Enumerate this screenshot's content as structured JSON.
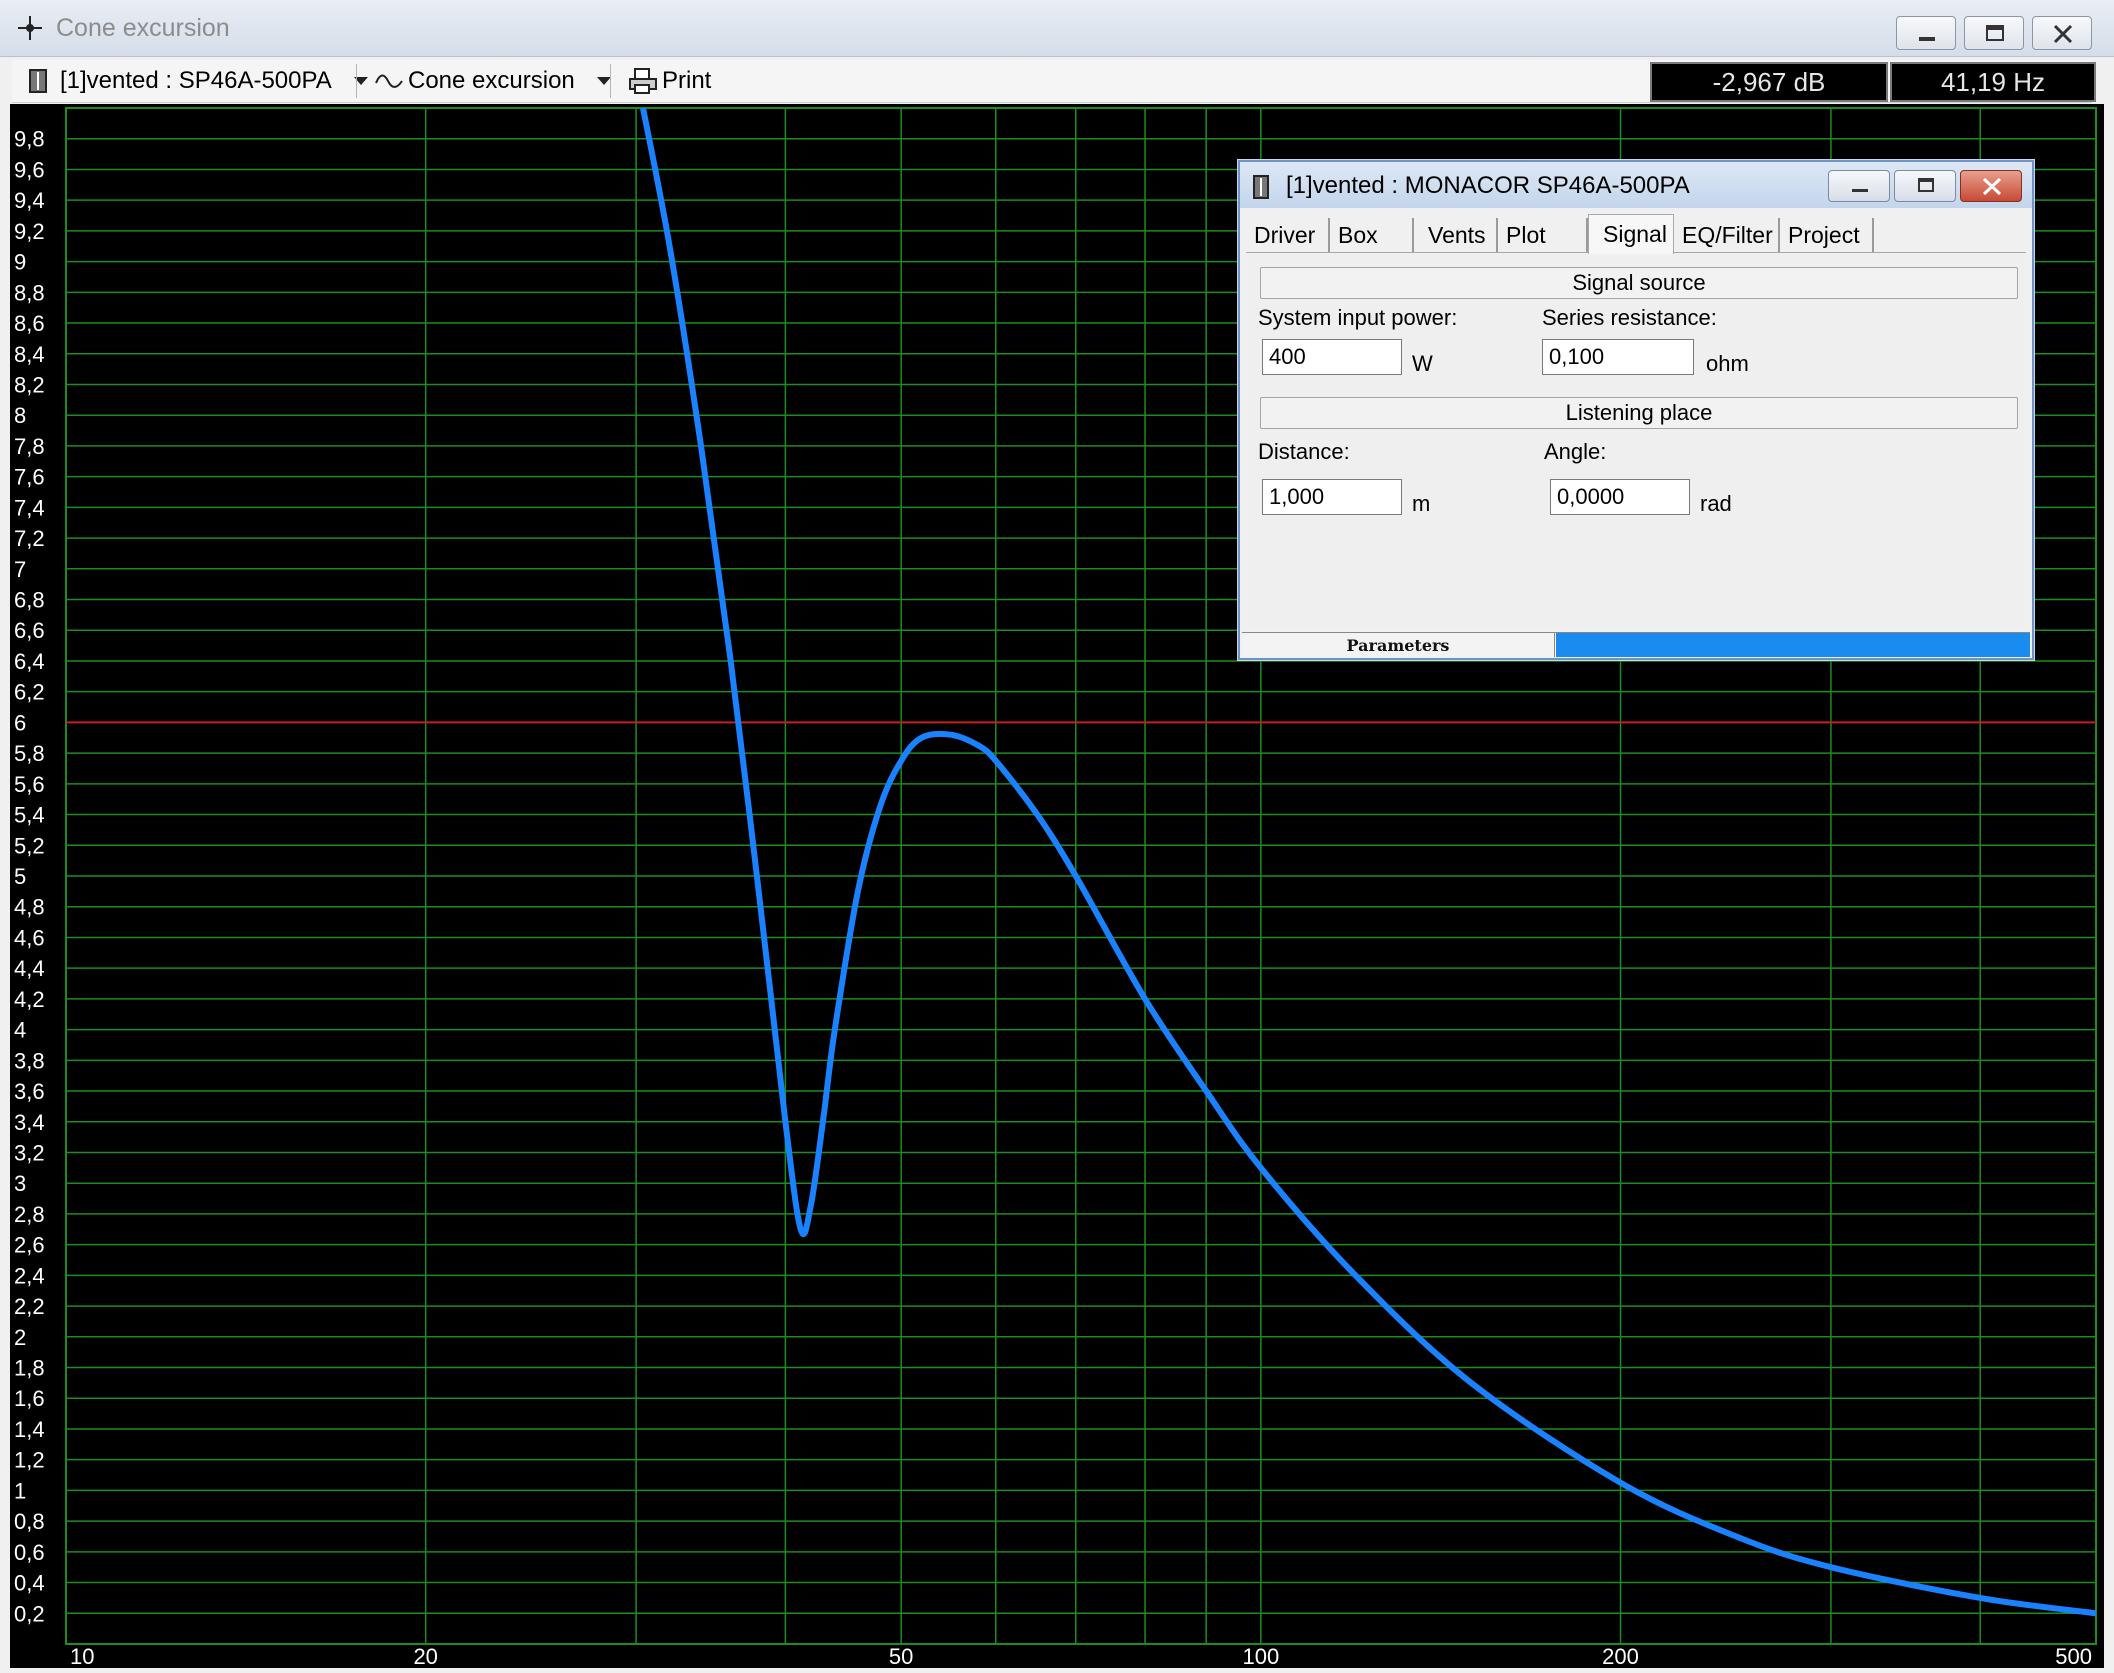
{
  "window": {
    "title": "Cone excursion"
  },
  "toolbar": {
    "project": "[1]vented : SP46A-500PA",
    "view": "Cone excursion",
    "print": "Print"
  },
  "readouts": {
    "level": "-2,967 dB",
    "frequency": "41,19 Hz"
  },
  "dialog": {
    "title": "[1]vented : MONACOR SP46A-500PA",
    "tabs": [
      "Driver",
      "Box",
      "Vents",
      "Plot",
      "Signal",
      "EQ/Filter",
      "Project"
    ],
    "active_tab": "Signal",
    "signal_source_header": "Signal source",
    "system_input_power_label": "System input power:",
    "system_input_power_value": "400",
    "system_input_power_unit": "W",
    "series_resistance_label": "Series resistance:",
    "series_resistance_value": "0,100",
    "series_resistance_unit": "ohm",
    "listening_place_header": "Listening place",
    "distance_label": "Distance:",
    "distance_value": "1,000",
    "distance_unit": "m",
    "angle_label": "Angle:",
    "angle_value": "0,0000",
    "angle_unit": "rad",
    "status_label": "Parameters"
  },
  "chart_data": {
    "type": "line",
    "x_scale": "log",
    "xlim": [
      10,
      500
    ],
    "ylim": [
      0,
      10
    ],
    "x_tick_labels": [
      "10",
      "20",
      "50",
      "100",
      "200",
      "500"
    ],
    "y_tick_labels": [
      "9,8",
      "9,6",
      "9,4",
      "9,2",
      "9",
      "8,8",
      "8,6",
      "8,4",
      "8,2",
      "8",
      "7,8",
      "7,6",
      "7,4",
      "7,2",
      "7",
      "6,8",
      "6,6",
      "6,4",
      "6,2",
      "6",
      "5,8",
      "5,6",
      "5,4",
      "5,2",
      "5",
      "4,8",
      "4,6",
      "4,4",
      "4,2",
      "4",
      "3,8",
      "3,6",
      "3,4",
      "3,2",
      "3",
      "2,8",
      "2,6",
      "2,4",
      "2,2",
      "2",
      "1,8",
      "1,6",
      "1,4",
      "1,2",
      "1",
      "0,8",
      "0,6",
      "0,4",
      "0,2"
    ],
    "limit_line": 6,
    "grid": true,
    "colors": {
      "curve": "#1a82ff",
      "grid": "#1e8c1e",
      "limit": "#c81e1e",
      "background": "#000000"
    },
    "x": [
      30.4,
      32,
      34,
      36,
      38,
      40,
      41.2,
      42,
      43,
      44,
      46,
      48,
      50,
      52,
      55,
      58,
      60,
      65,
      70,
      80,
      90,
      100,
      120,
      150,
      200,
      250,
      300,
      400,
      500
    ],
    "y": [
      10.0,
      9.1,
      7.8,
      6.4,
      4.9,
      3.4,
      2.7,
      2.85,
      3.4,
      4.0,
      4.9,
      5.45,
      5.75,
      5.9,
      5.92,
      5.85,
      5.75,
      5.4,
      5.0,
      4.2,
      3.6,
      3.1,
      2.4,
      1.7,
      1.05,
      0.7,
      0.5,
      0.3,
      0.2
    ]
  }
}
